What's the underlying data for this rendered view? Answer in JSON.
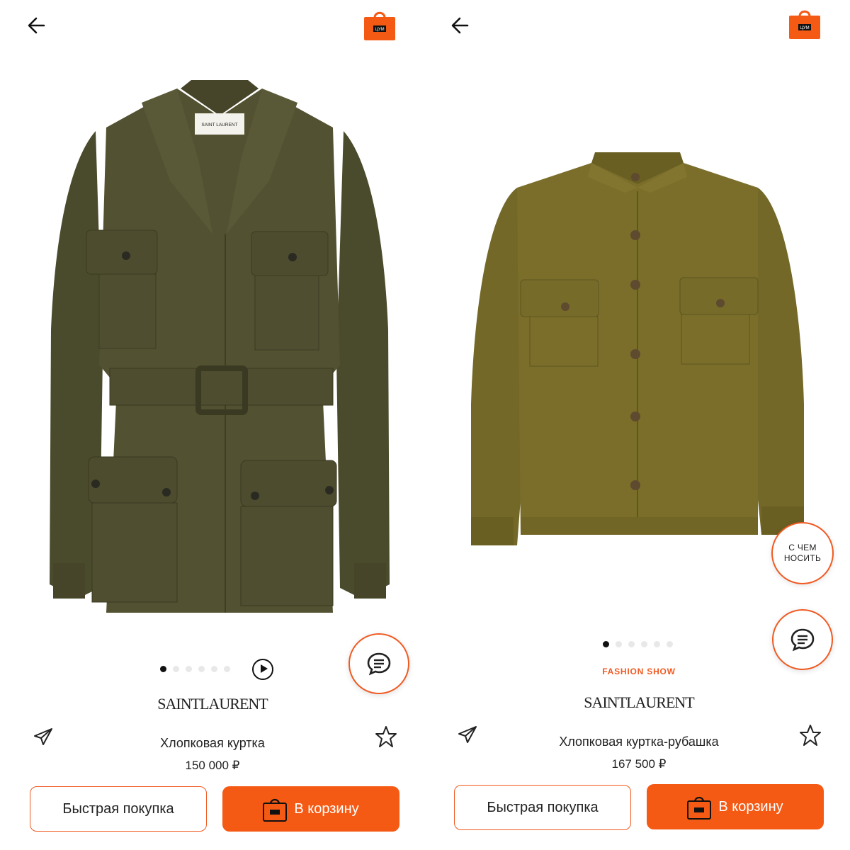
{
  "colors": {
    "accent": "#f05a22",
    "button_fill": "#f55a14",
    "jacket_left": "#4f4e30",
    "jacket_right": "#7a6e2a"
  },
  "icons": {
    "back": "arrow-left-icon",
    "bag": "shopping-bag-icon",
    "chat": "chat-bubble-icon",
    "play": "play-icon",
    "share": "paper-plane-icon",
    "favorite": "star-icon"
  },
  "bag_logo_text": "ЦУМ",
  "left": {
    "product_image": "khaki belted safari jacket with four flap pockets",
    "label_text": "SAINT LAURENT",
    "gallery": {
      "count": 6,
      "active": 1
    },
    "brand": "SAINTLAURENT",
    "title": "Хлопковая куртка",
    "price": "150 000 ₽",
    "buttons": {
      "quick_buy": "Быстрая покупка",
      "add_to_cart": "В корзину"
    }
  },
  "right": {
    "product_image": "olive cotton overshirt jacket with two chest pockets",
    "gallery": {
      "count": 6,
      "active": 1
    },
    "tag": "FASHION SHOW",
    "what_to_wear": "С ЧЕМ НОСИТЬ",
    "brand": "SAINTLAURENT",
    "title": "Хлопковая куртка-рубашка",
    "price": "167 500 ₽",
    "buttons": {
      "quick_buy": "Быстрая покупка",
      "add_to_cart": "В корзину"
    }
  }
}
